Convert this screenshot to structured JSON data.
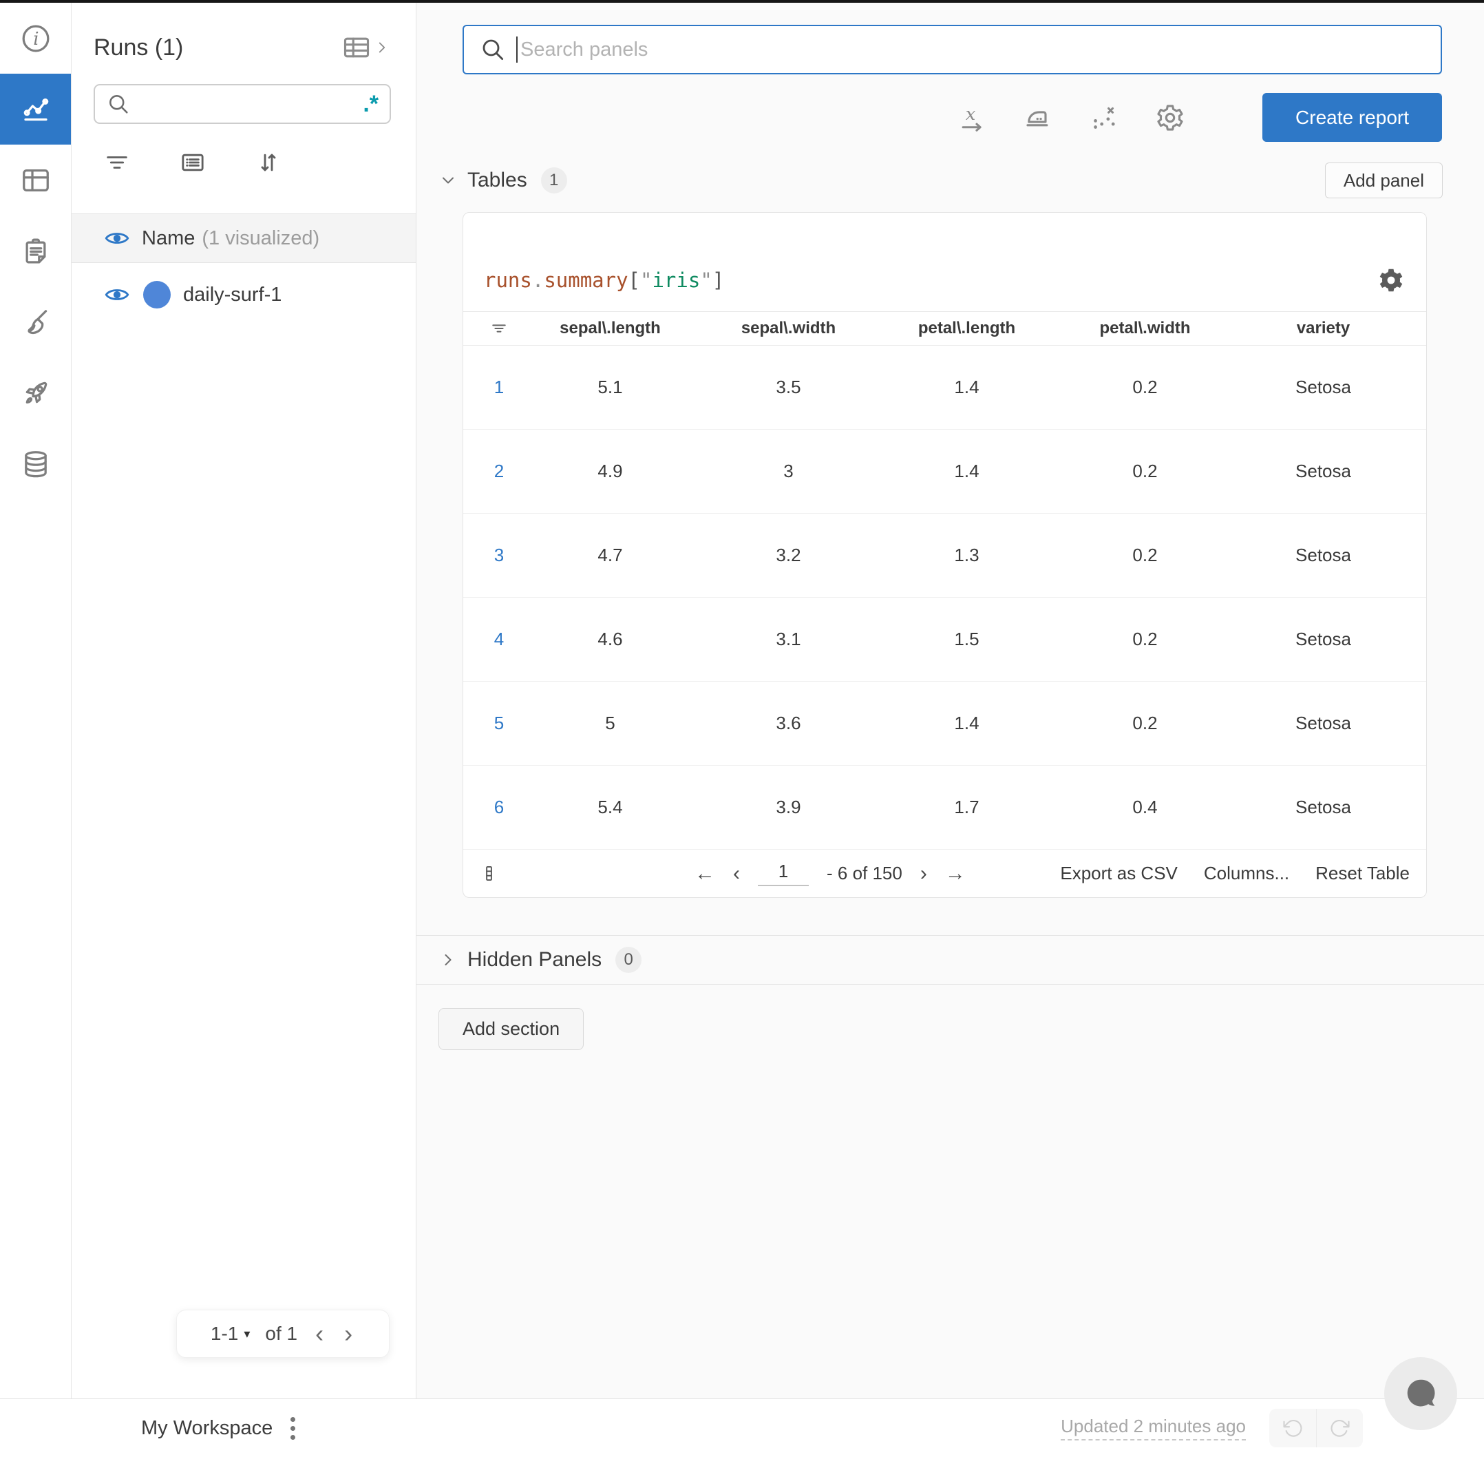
{
  "app": {
    "accent_color": "#2e78c7",
    "teal_color": "#0a9bad",
    "run_dot_color": "#4f86d8"
  },
  "nav": {
    "icons": [
      "info-icon",
      "line-chart-icon",
      "panels-icon",
      "notes-icon",
      "sweep-icon",
      "rocket-icon",
      "artifacts-icon"
    ],
    "active": "line-chart-icon"
  },
  "glyphs": {
    "caret_down": "▾",
    "chevron_left": "‹",
    "chevron_right": "›",
    "arrow_left": "←",
    "arrow_right": "→"
  },
  "sidebar": {
    "title": "Runs (1)",
    "search": {
      "placeholder": "",
      "regex_label": ".*"
    },
    "header_row": {
      "name": "Name",
      "visualized": "(1 visualized)"
    },
    "runs": [
      {
        "name": "daily-surf-1",
        "dot_color": "#4f86d8"
      }
    ],
    "pagination": {
      "range": "1-1",
      "of": "of 1"
    }
  },
  "topbar": {
    "search_placeholder": "Search panels",
    "create_report": "Create report"
  },
  "sections": {
    "tables": {
      "label": "Tables",
      "count": "1",
      "add_panel": "Add panel"
    },
    "hidden": {
      "label": "Hidden Panels",
      "count": "0"
    },
    "add_section": "Add section"
  },
  "panel": {
    "title_tokens": [
      {
        "text": "runs",
        "color": "#a8512c"
      },
      {
        "text": ".",
        "color": "#8f8f8f"
      },
      {
        "text": "summary",
        "color": "#a8512c"
      },
      {
        "text": "[",
        "color": "#555555"
      },
      {
        "text": "\"",
        "color": "#8f8f8f"
      },
      {
        "text": "iris",
        "color": "#0e8a60"
      },
      {
        "text": "\"",
        "color": "#8f8f8f"
      },
      {
        "text": "]",
        "color": "#555555"
      }
    ],
    "table": {
      "columns": [
        "sepal\\.length",
        "sepal\\.width",
        "petal\\.length",
        "petal\\.width",
        "variety"
      ],
      "rows": [
        {
          "index": "1",
          "values": [
            "5.1",
            "3.5",
            "1.4",
            "0.2",
            "Setosa"
          ]
        },
        {
          "index": "2",
          "values": [
            "4.9",
            "3",
            "1.4",
            "0.2",
            "Setosa"
          ]
        },
        {
          "index": "3",
          "values": [
            "4.7",
            "3.2",
            "1.3",
            "0.2",
            "Setosa"
          ]
        },
        {
          "index": "4",
          "values": [
            "4.6",
            "3.1",
            "1.5",
            "0.2",
            "Setosa"
          ]
        },
        {
          "index": "5",
          "values": [
            "5",
            "3.6",
            "1.4",
            "0.2",
            "Setosa"
          ]
        },
        {
          "index": "6",
          "values": [
            "5.4",
            "3.9",
            "1.7",
            "0.4",
            "Setosa"
          ]
        }
      ],
      "footer": {
        "page": "1",
        "range": "- 6 of 150",
        "export": "Export as CSV",
        "columns": "Columns...",
        "reset": "Reset Table"
      }
    }
  },
  "statusbar": {
    "workspace": "My Workspace",
    "updated": "Updated 2 minutes ago"
  }
}
